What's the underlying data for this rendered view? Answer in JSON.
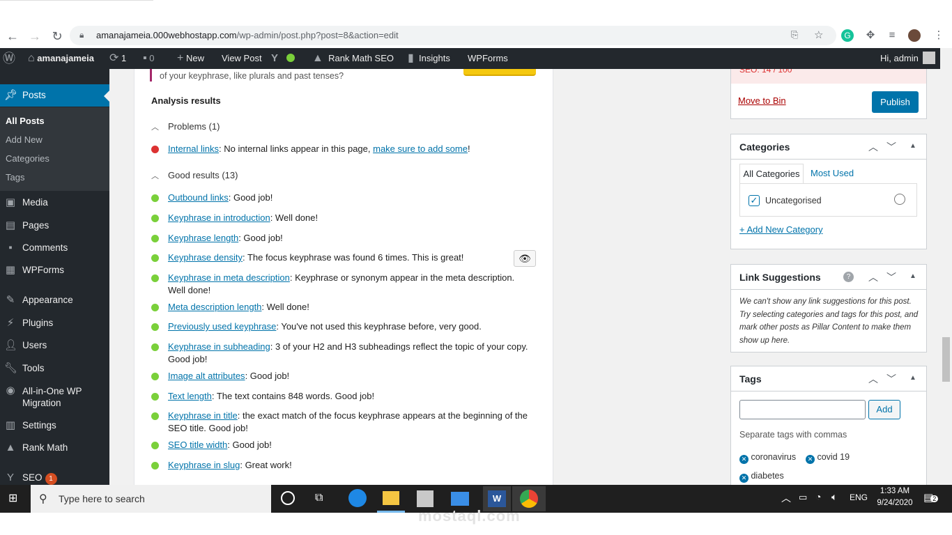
{
  "browser": {
    "url_host": "amanajameia.000webhostapp.com",
    "url_path": "/wp-admin/post.php?post=8&action=edit"
  },
  "adminbar": {
    "site_name": "amanajameia",
    "updates_count": "1",
    "comments_count": "0",
    "new_label": "New",
    "view_post_label": "View Post",
    "rank_math_label": "Rank Math SEO",
    "insights_label": "Insights",
    "wpforms_label": "WPForms",
    "greeting": "Hi, admin"
  },
  "sidebar": {
    "posts_label": "Posts",
    "submenu": [
      "All Posts",
      "Add New",
      "Categories",
      "Tags"
    ],
    "items": [
      {
        "label": "Media"
      },
      {
        "label": "Pages"
      },
      {
        "label": "Comments"
      },
      {
        "label": "WPForms"
      },
      {
        "label": "Appearance"
      },
      {
        "label": "Plugins"
      },
      {
        "label": "Users"
      },
      {
        "label": "Tools"
      },
      {
        "label": "All-in-One WP Migration"
      },
      {
        "label": "Settings"
      },
      {
        "label": "Rank Math"
      },
      {
        "label": "SEO"
      }
    ],
    "seo_badge": "1"
  },
  "analysis": {
    "top_text": "of your keyphrase, like plurals and past tenses?",
    "heading": "Analysis results",
    "problems_header": "Problems (1)",
    "problem": {
      "link": "Internal links",
      "text": ": No internal links appear in this page, ",
      "link2": "make sure to add some",
      "tail": "!"
    },
    "good_header": "Good results (13)",
    "good": [
      {
        "link": "Outbound links",
        "text": ": Good job!"
      },
      {
        "link": "Keyphrase in introduction",
        "text": ": Well done!"
      },
      {
        "link": "Keyphrase length",
        "text": ": Good job!"
      },
      {
        "link": "Keyphrase density",
        "text": ": The focus keyphrase was found 6 times. This is great!"
      },
      {
        "link": "Keyphrase in meta description",
        "text": ": Keyphrase or synonym appear in the meta description. Well done!"
      },
      {
        "link": "Meta description length",
        "text": ": Well done!"
      },
      {
        "link": "Previously used keyphrase",
        "text": ": You've not used this keyphrase before, very good."
      },
      {
        "link": "Keyphrase in subheading",
        "text": ": 3 of your H2 and H3 subheadings reflect the topic of your copy. Good job!"
      },
      {
        "link": "Image alt attributes",
        "text": ": Good job!"
      },
      {
        "link": "Text length",
        "text": ": The text contains 848 words. Good job!"
      },
      {
        "link": "Keyphrase in title",
        "text": ": the exact match of the focus keyphrase appears at the beginning of the SEO title. Good job!"
      },
      {
        "link": "SEO title width",
        "text": ": Good job!"
      },
      {
        "link": "Keyphrase in slug",
        "text": ": Great work!"
      }
    ]
  },
  "publish_box": {
    "seo_score": "SEO: 14 / 100",
    "move_to_bin": "Move to Bin",
    "publish": "Publish"
  },
  "categories_box": {
    "title": "Categories",
    "tab_all": "All Categories",
    "tab_used": "Most Used",
    "item": "Uncategorised",
    "add_new": "+ Add New Category"
  },
  "link_box": {
    "title": "Link Suggestions",
    "text": "We can't show any link suggestions for this post. Try selecting categories and tags for this post, and mark other posts as Pillar Content to make them show up here."
  },
  "tags_box": {
    "title": "Tags",
    "add": "Add",
    "hint": "Separate tags with commas",
    "tags": [
      "coronavirus",
      "covid 19",
      "diabetes"
    ]
  },
  "taskbar": {
    "search_placeholder": "Type here to search",
    "lang": "ENG",
    "time": "1:33 AM",
    "date": "9/24/2020",
    "notif": "2"
  },
  "watermark": {
    "text": "mostaql.com"
  }
}
